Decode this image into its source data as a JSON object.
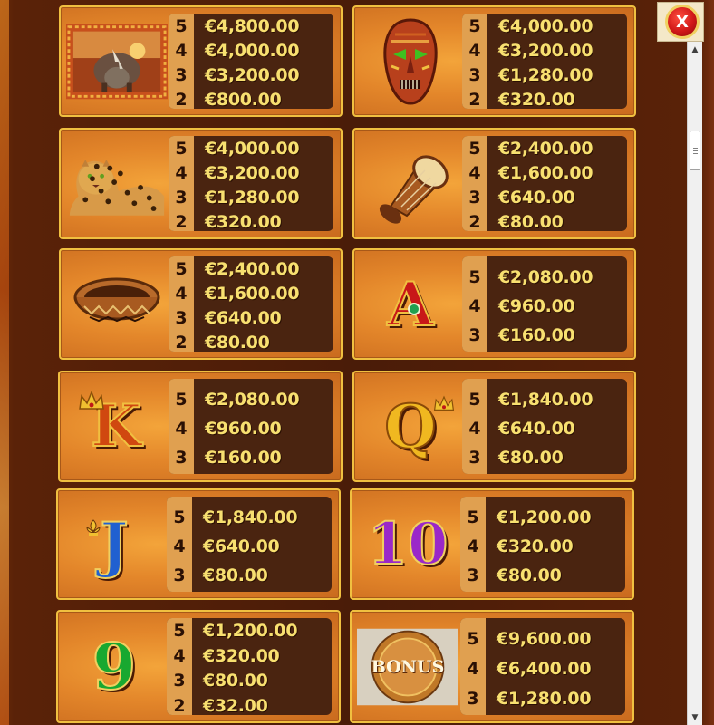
{
  "close_label": "X",
  "scroll_up_glyph": "▲",
  "scroll_down_glyph": "▼",
  "paytable": [
    {
      "symbol": "Rhino",
      "icon": "rhino-icon",
      "rows": [
        {
          "count": "5",
          "value": "€4,800.00"
        },
        {
          "count": "4",
          "value": "€4,000.00"
        },
        {
          "count": "3",
          "value": "€3,200.00"
        },
        {
          "count": "2",
          "value": "€800.00"
        }
      ]
    },
    {
      "symbol": "Tribal mask",
      "icon": "mask-icon",
      "rows": [
        {
          "count": "5",
          "value": "€4,000.00"
        },
        {
          "count": "4",
          "value": "€3,200.00"
        },
        {
          "count": "3",
          "value": "€1,280.00"
        },
        {
          "count": "2",
          "value": "€320.00"
        }
      ]
    },
    {
      "symbol": "Leopard",
      "icon": "leopard-icon",
      "rows": [
        {
          "count": "5",
          "value": "€4,000.00"
        },
        {
          "count": "4",
          "value": "€3,200.00"
        },
        {
          "count": "3",
          "value": "€1,280.00"
        },
        {
          "count": "2",
          "value": "€320.00"
        }
      ]
    },
    {
      "symbol": "Drum",
      "icon": "drum-icon",
      "rows": [
        {
          "count": "5",
          "value": "€2,400.00"
        },
        {
          "count": "4",
          "value": "€1,600.00"
        },
        {
          "count": "3",
          "value": "€640.00"
        },
        {
          "count": "2",
          "value": "€80.00"
        }
      ]
    },
    {
      "symbol": "Basket",
      "icon": "basket-icon",
      "rows": [
        {
          "count": "5",
          "value": "€2,400.00"
        },
        {
          "count": "4",
          "value": "€1,600.00"
        },
        {
          "count": "3",
          "value": "€640.00"
        },
        {
          "count": "2",
          "value": "€80.00"
        }
      ]
    },
    {
      "symbol": "A",
      "icon": "letter-a-icon",
      "rows": [
        {
          "count": "5",
          "value": "€2,080.00"
        },
        {
          "count": "4",
          "value": "€960.00"
        },
        {
          "count": "3",
          "value": "€160.00"
        }
      ]
    },
    {
      "symbol": "K",
      "icon": "letter-k-icon",
      "rows": [
        {
          "count": "5",
          "value": "€2,080.00"
        },
        {
          "count": "4",
          "value": "€960.00"
        },
        {
          "count": "3",
          "value": "€160.00"
        }
      ]
    },
    {
      "symbol": "Q",
      "icon": "letter-q-icon",
      "rows": [
        {
          "count": "5",
          "value": "€1,840.00"
        },
        {
          "count": "4",
          "value": "€640.00"
        },
        {
          "count": "3",
          "value": "€80.00"
        }
      ]
    },
    {
      "symbol": "J",
      "icon": "letter-j-icon",
      "rows": [
        {
          "count": "5",
          "value": "€1,840.00"
        },
        {
          "count": "4",
          "value": "€640.00"
        },
        {
          "count": "3",
          "value": "€80.00"
        }
      ]
    },
    {
      "symbol": "10",
      "icon": "ten-icon",
      "rows": [
        {
          "count": "5",
          "value": "€1,200.00"
        },
        {
          "count": "4",
          "value": "€320.00"
        },
        {
          "count": "3",
          "value": "€80.00"
        }
      ]
    },
    {
      "symbol": "9",
      "icon": "nine-icon",
      "rows": [
        {
          "count": "5",
          "value": "€1,200.00"
        },
        {
          "count": "4",
          "value": "€320.00"
        },
        {
          "count": "3",
          "value": "€80.00"
        },
        {
          "count": "2",
          "value": "€32.00"
        }
      ]
    },
    {
      "symbol": "BONUS",
      "icon": "bonus-coin-icon",
      "rows": [
        {
          "count": "5",
          "value": "€9,600.00"
        },
        {
          "count": "4",
          "value": "€6,400.00"
        },
        {
          "count": "3",
          "value": "€1,280.00"
        }
      ]
    }
  ],
  "symbol_texts": {
    "a": "A",
    "k": "K",
    "q": "Q",
    "j": "J",
    "ten": "10",
    "nine": "9",
    "bonus": "BONUS"
  },
  "colors": {
    "panel_border": "#f0c040",
    "value_text": "#f8e070",
    "table_bg": "#4a2410",
    "close_button": "#d01818"
  }
}
